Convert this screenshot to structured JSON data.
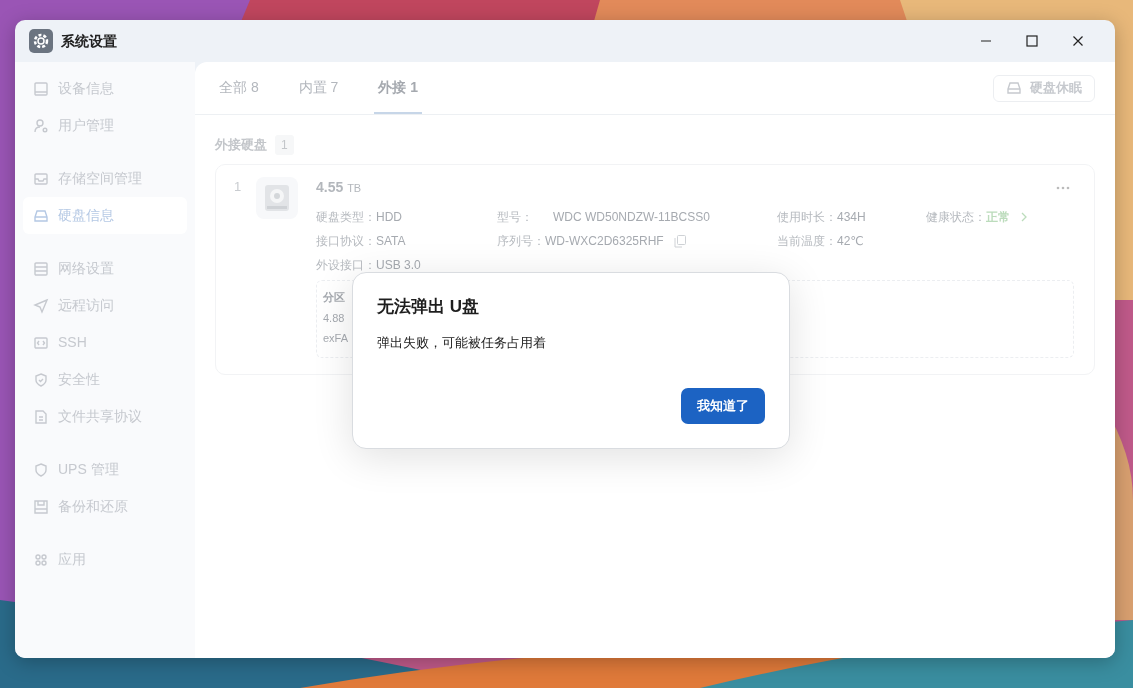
{
  "window": {
    "title": "系统设置"
  },
  "sidebar": {
    "groups": [
      {
        "items": [
          {
            "label": "设备信息",
            "selected": false
          },
          {
            "label": "用户管理",
            "selected": false
          }
        ]
      },
      {
        "items": [
          {
            "label": "存储空间管理",
            "selected": false
          },
          {
            "label": "硬盘信息",
            "selected": true
          }
        ]
      },
      {
        "items": [
          {
            "label": "网络设置",
            "selected": false
          },
          {
            "label": "远程访问",
            "selected": false
          },
          {
            "label": "SSH",
            "selected": false
          },
          {
            "label": "安全性",
            "selected": false
          },
          {
            "label": "文件共享协议",
            "selected": false
          }
        ]
      },
      {
        "items": [
          {
            "label": "UPS 管理",
            "selected": false
          },
          {
            "label": "备份和还原",
            "selected": false
          }
        ]
      },
      {
        "items": [
          {
            "label": "应用",
            "selected": false
          }
        ]
      }
    ]
  },
  "tabs": [
    {
      "label": "全部 8",
      "selected": false
    },
    {
      "label": "内置 7",
      "selected": false
    },
    {
      "label": "外接 1",
      "selected": true
    }
  ],
  "sleep_button": {
    "label": "硬盘休眠"
  },
  "section": {
    "title": "外接硬盘",
    "count": "1"
  },
  "disks": [
    {
      "index": "1",
      "size": "4.55",
      "unit": "TB",
      "columns": [
        [
          {
            "label": "硬盘类型：",
            "value": "HDD",
            "kind": "plain"
          },
          {
            "label": "接口协议：",
            "value": "SATA",
            "kind": "plain"
          },
          {
            "label": "外设接口：",
            "value": "USB 3.0",
            "kind": "plain"
          }
        ],
        [
          {
            "label": "型号：",
            "value": "WDC WD50NDZW-11BCSS0",
            "kind": "wide"
          },
          {
            "label": "序列号：",
            "value": "WD-WXC2D6325RHF",
            "kind": "copy"
          }
        ],
        [
          {
            "label": "使用时长：",
            "value": "434H",
            "kind": "plain"
          },
          {
            "label": "当前温度：",
            "value": "42℃",
            "kind": "plain"
          }
        ],
        [
          {
            "label": "健康状态：",
            "value": "正常",
            "kind": "status"
          }
        ]
      ],
      "partition": {
        "title": "分区",
        "lines": [
          "4.88",
          "exFA"
        ]
      }
    }
  ],
  "dialog": {
    "title": "无法弹出 U盘",
    "message": "弹出失败，可能被任务占用着",
    "button": "我知道了"
  }
}
